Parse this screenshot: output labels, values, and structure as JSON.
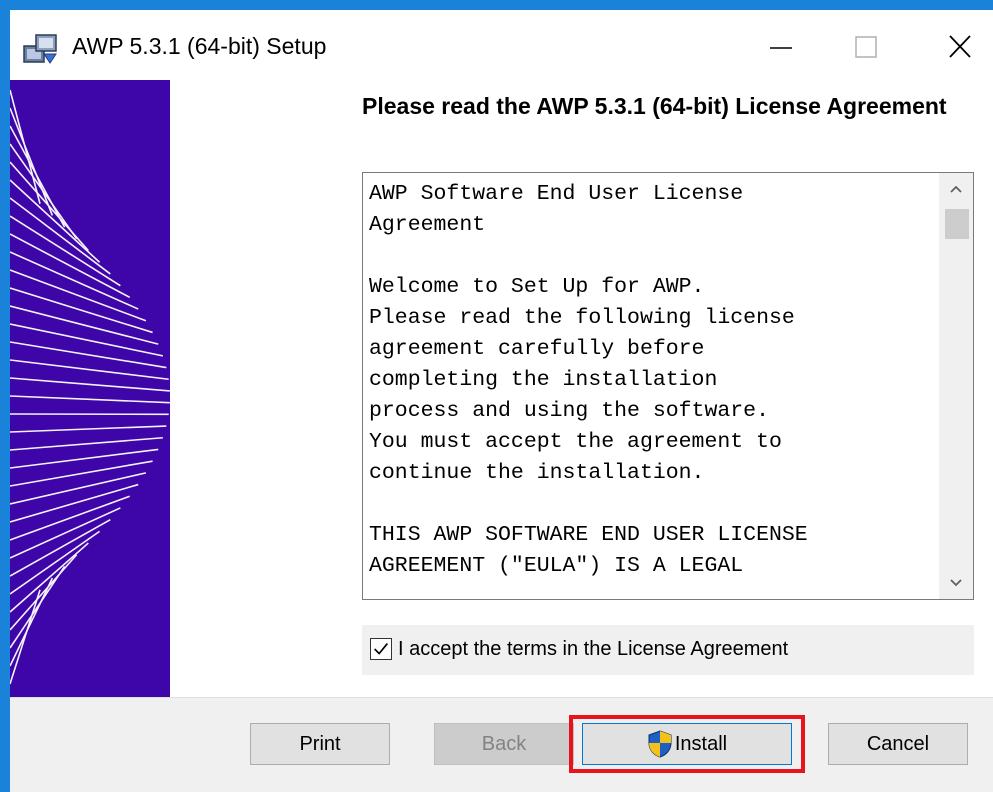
{
  "window": {
    "title": "AWP 5.3.1 (64-bit) Setup",
    "icon": "installer-icon",
    "controls": [
      "minimize-icon",
      "maximize-icon",
      "close-icon"
    ]
  },
  "license": {
    "heading": "Please read the AWP 5.3.1 (64-bit) License Agreement",
    "lines": [
      "AWP Software End User License",
      "Agreement",
      "",
      "Welcome to Set Up for AWP.",
      "Please read the following license",
      "agreement carefully before",
      "completing the installation",
      "process and using the software.",
      "You must accept the agreement to",
      "continue the installation.",
      "",
      "THIS AWP SOFTWARE END USER LICENSE",
      "AGREEMENT (\"EULA\") IS A LEGAL"
    ]
  },
  "accept": {
    "label": "I accept the terms in the License Agreement",
    "checked": true
  },
  "buttons": {
    "print": "Print",
    "back": "Back",
    "install": "Install",
    "cancel": "Cancel"
  },
  "colors": {
    "banner": "#3e06a8",
    "highlight": "#e8141c",
    "frame": "#1a82d8"
  }
}
